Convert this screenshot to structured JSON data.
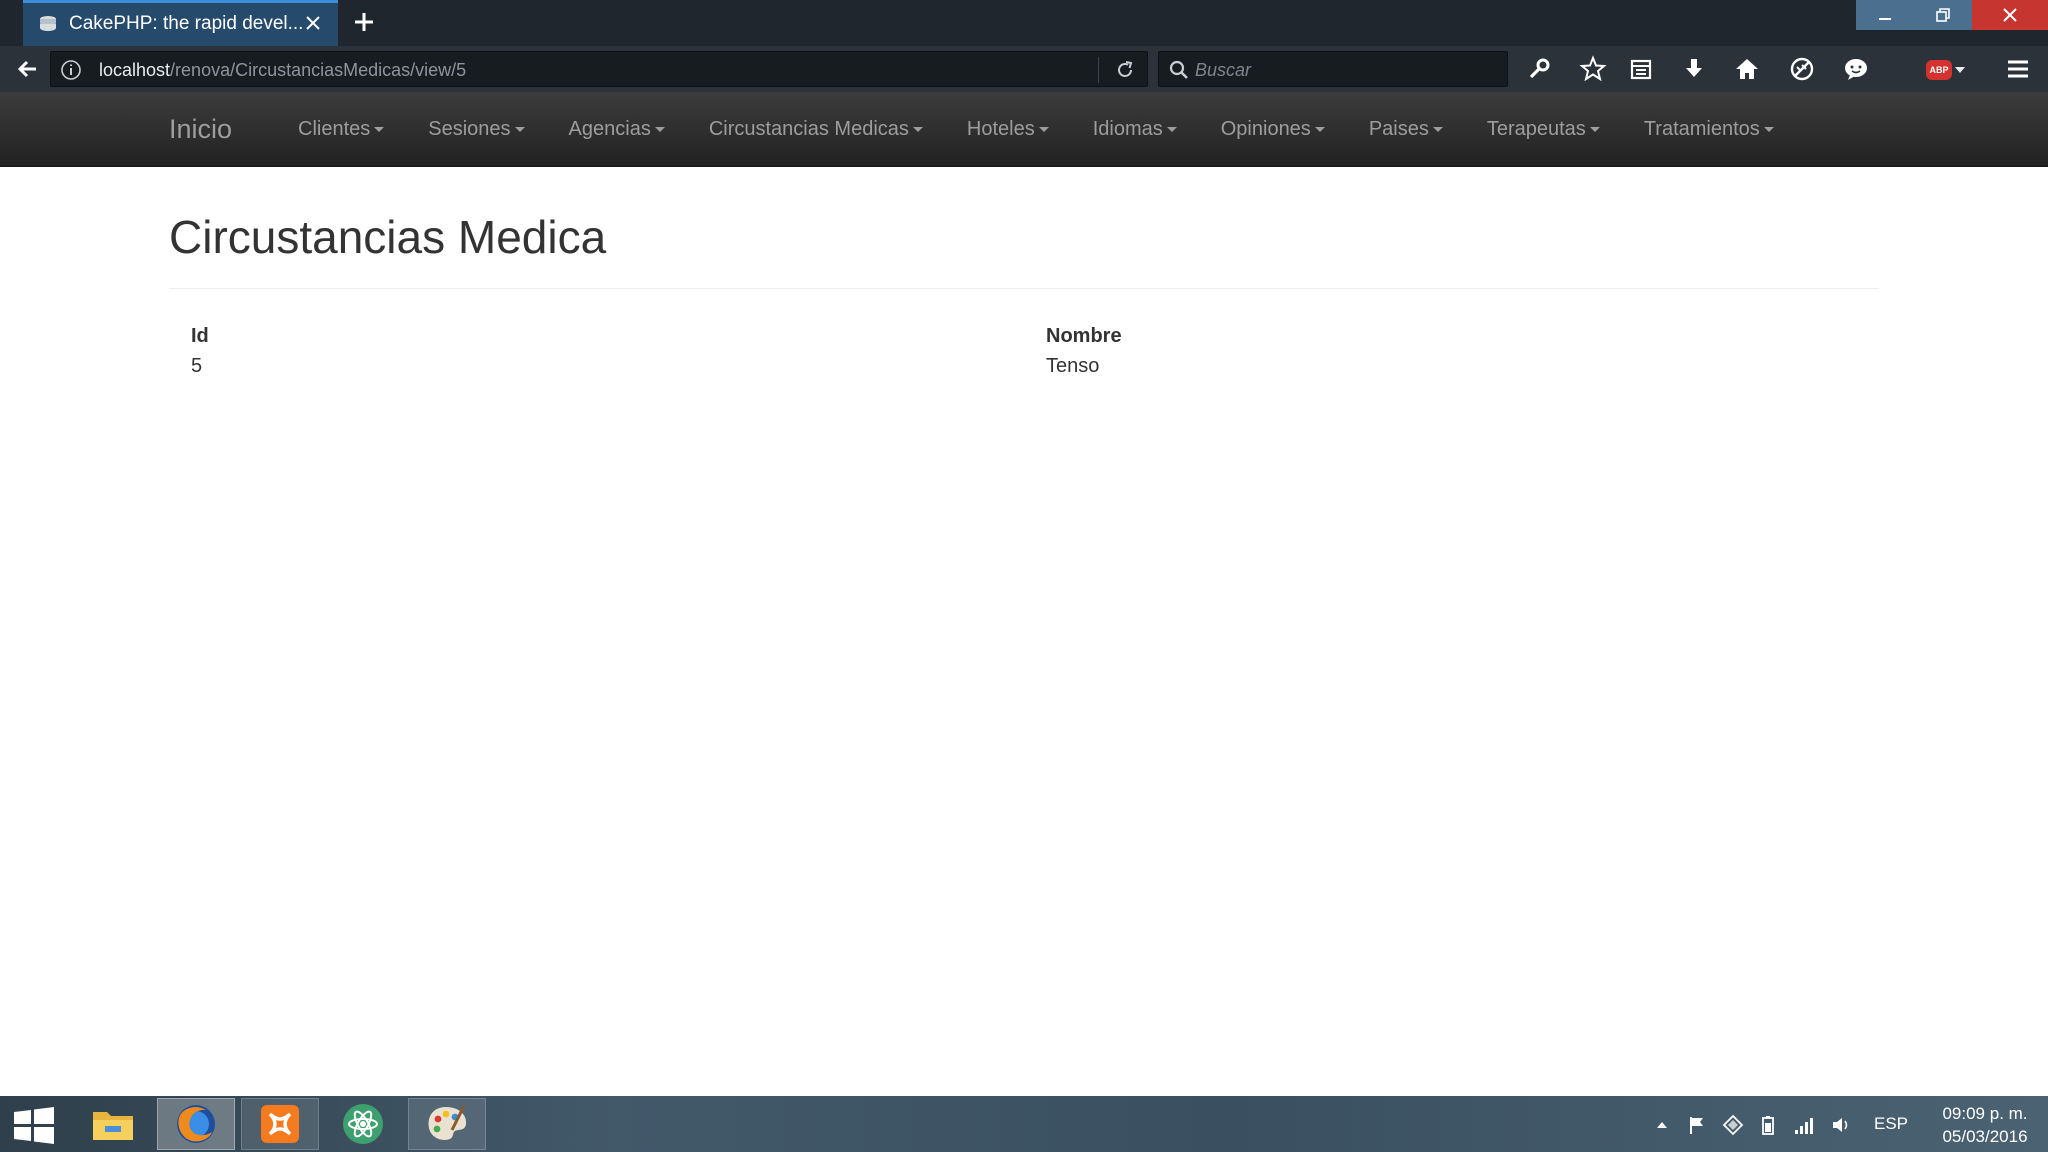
{
  "browser": {
    "tab_title": "CakePHP: the rapid devel...",
    "url_host": "localhost",
    "url_path": "/renova/CircustanciasMedicas/view/5",
    "search_placeholder": "Buscar",
    "abp_label": "ABP"
  },
  "site_nav": {
    "brand": "Inicio",
    "items": [
      {
        "label": "Clientes"
      },
      {
        "label": "Sesiones"
      },
      {
        "label": "Agencias"
      },
      {
        "label": "Circustancias Medicas"
      },
      {
        "label": "Hoteles"
      },
      {
        "label": "Idiomas"
      },
      {
        "label": "Opiniones"
      },
      {
        "label": "Paises"
      },
      {
        "label": "Terapeutas"
      },
      {
        "label": "Tratamientos"
      }
    ]
  },
  "page": {
    "title": "Circustancias Medica",
    "fields": [
      {
        "label": "Id",
        "value": "5"
      },
      {
        "label": "Nombre",
        "value": "Tenso"
      }
    ]
  },
  "taskbar": {
    "apps": [
      "file-explorer",
      "firefox",
      "xampp",
      "atom",
      "paint"
    ],
    "language": "ESP",
    "time": "09:09 p. m.",
    "date": "05/03/2016"
  },
  "colors": {
    "tab_active": "#254a6c",
    "navbar_bg": "#2b2b2b",
    "nav_text": "#9d9d9d",
    "close_button": "#c6352f"
  }
}
